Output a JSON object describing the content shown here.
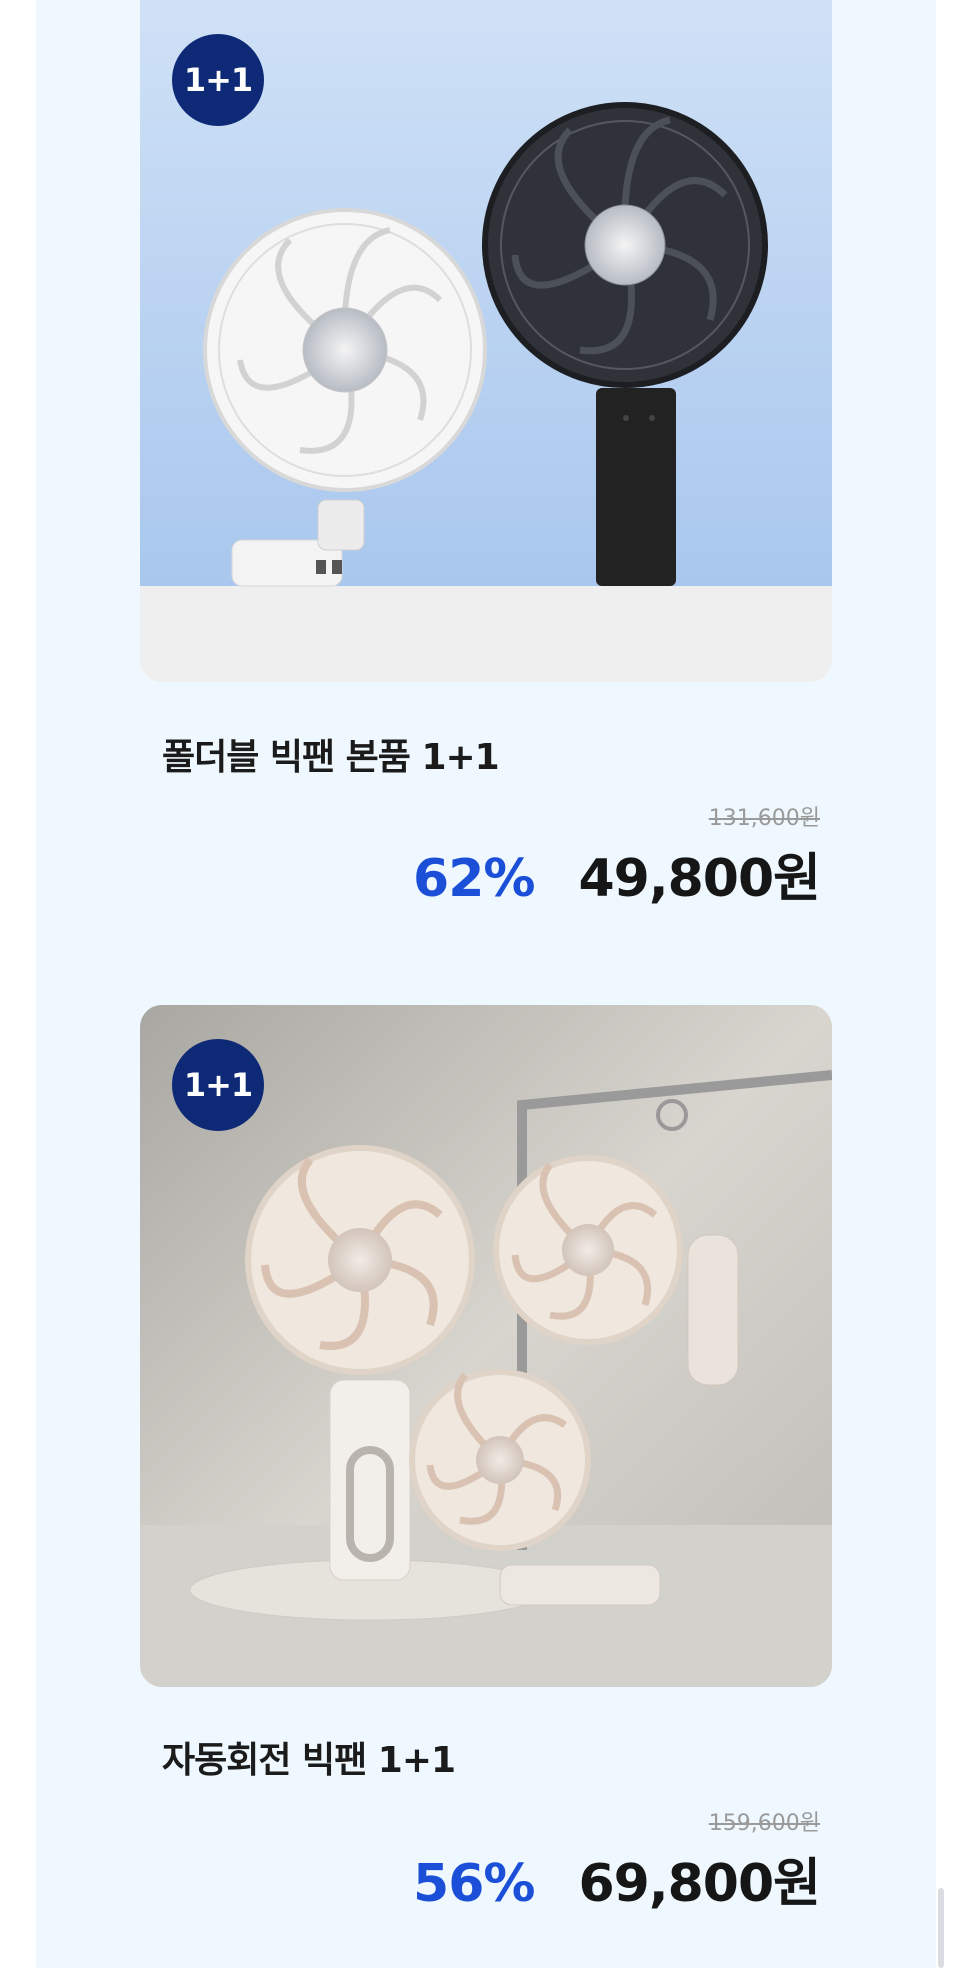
{
  "products": [
    {
      "badge": "1+1",
      "title": "폴더블 빅팬 본품 1+1",
      "original_price": "131,600원",
      "discount": "62%",
      "sale_price": "49,800원",
      "colors": [
        "white",
        "black"
      ]
    },
    {
      "badge": "1+1",
      "title": "자동회전 빅팬 1+1",
      "original_price": "159,600원",
      "discount": "56%",
      "sale_price": "69,800원",
      "colors": [
        "beige"
      ]
    }
  ],
  "colors": {
    "panel_bg": "#eef8fe",
    "badge_bg": "#0e2a76",
    "discount": "#1b4fd8"
  }
}
